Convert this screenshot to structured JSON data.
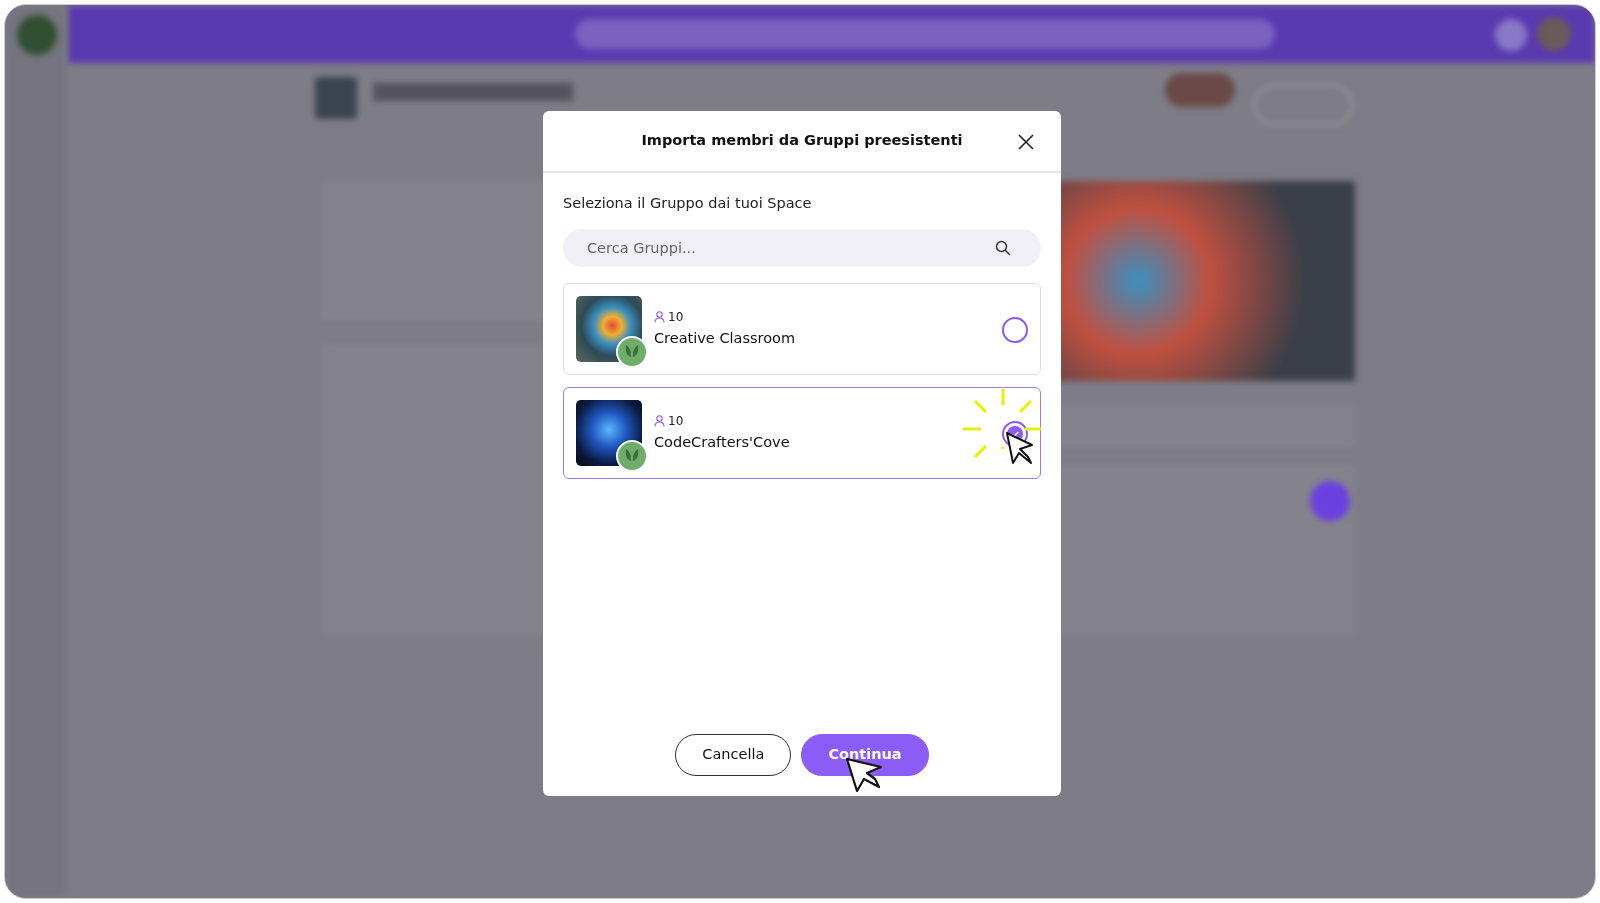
{
  "dialog": {
    "title": "Importa membri da Gruppi preesistenti",
    "prompt": "Seleziona il Gruppo dai tuoi Space",
    "search": {
      "placeholder": "Cerca Gruppi..."
    },
    "groups": [
      {
        "name": "Creative Classroom",
        "members": "10",
        "selected": false
      },
      {
        "name": "CodeCrafters'Cove",
        "members": "10",
        "selected": true
      }
    ],
    "buttons": [
      {
        "label": "Cancella",
        "kind": "secondary"
      },
      {
        "label": "Continua",
        "kind": "primary"
      }
    ]
  }
}
